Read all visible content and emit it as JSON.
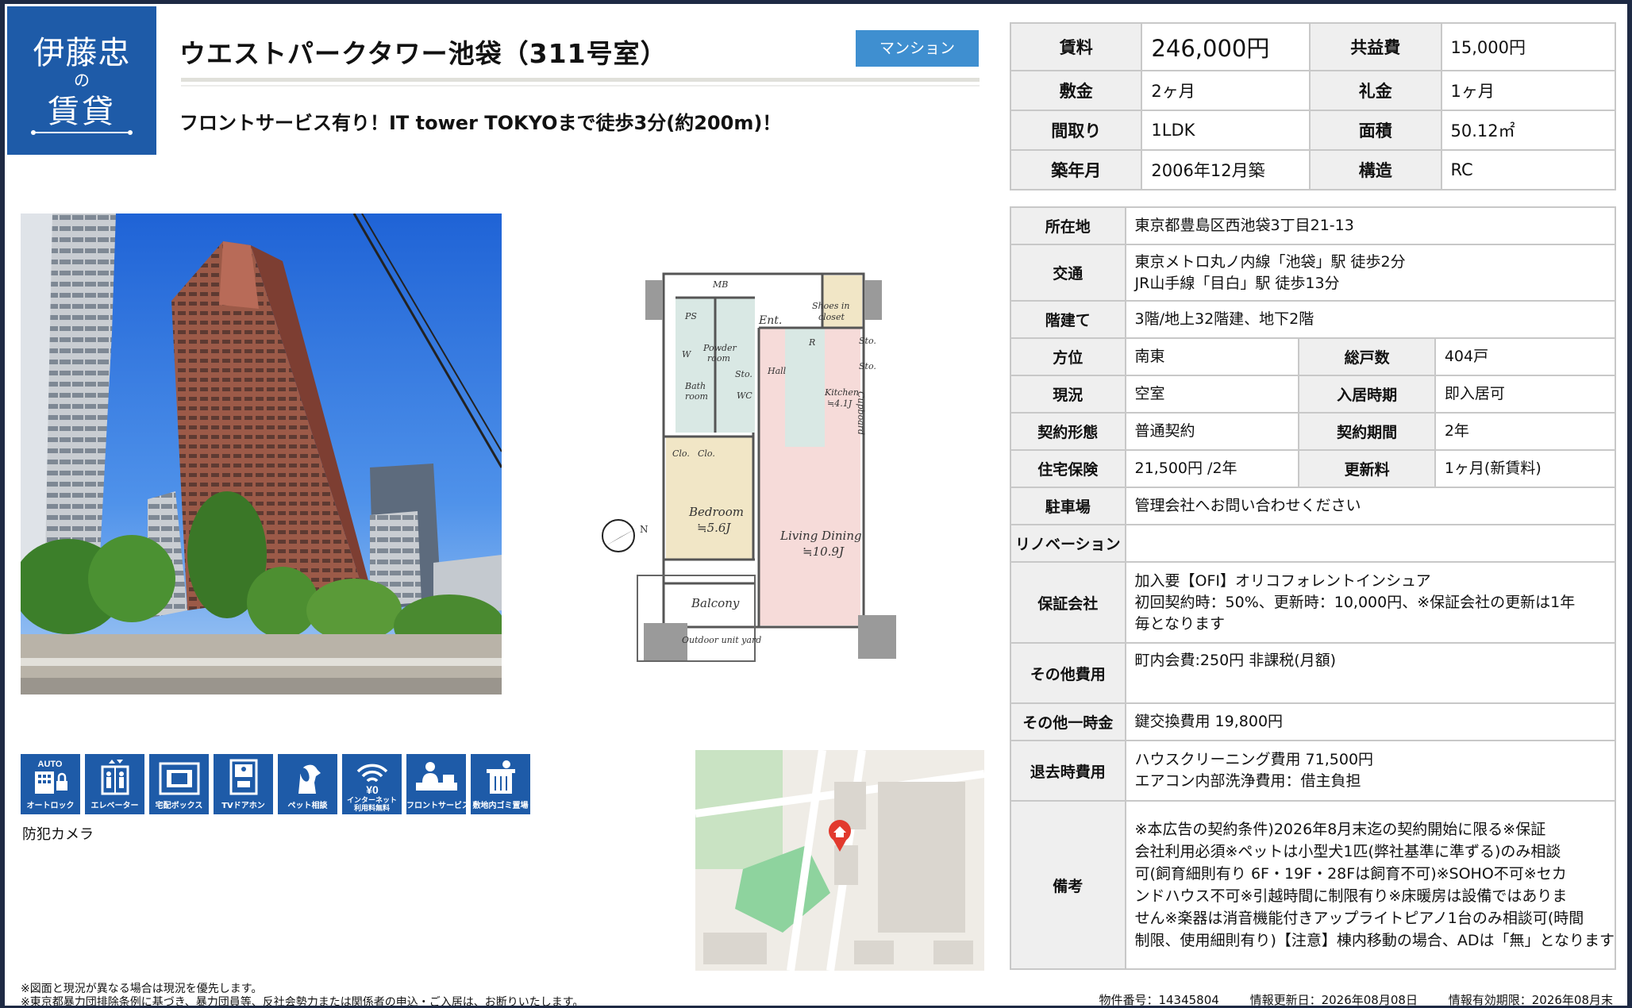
{
  "logo": {
    "line1": "伊藤忠",
    "line2": "の",
    "line3": "賃貸"
  },
  "property": {
    "title": "ウエストパークタワー池袋（311号室）",
    "type_badge": "マンション",
    "catch_copy": "フロントサービス有り！IT tower TOKYOまで徒歩3分(約200m)！"
  },
  "floorplan": {
    "labels": {
      "mb": "MB",
      "ps": "PS",
      "ent": "Ent.",
      "shoes1": "Shoes in",
      "shoes2": "closet",
      "powder1": "Powder",
      "powder2": "room",
      "w": "W",
      "sto1": "Sto.",
      "hall": "Hall",
      "r": "R",
      "sto2": "Sto.",
      "sto3": "Sto.",
      "bath1": "Bath",
      "bath2": "room",
      "wc": "WC",
      "kitchen1": "Kitchen",
      "kitchen2": "≒4.1J",
      "cupboard": "Cupboard",
      "clo1": "Clo.",
      "clo2": "Clo.",
      "bedroom1": "Bedroom",
      "bedroom2": "≒5.6J",
      "living1": "Living Dining",
      "living2": "≒10.9J",
      "balcony": "Balcony",
      "outdoor": "Outdoor unit yard",
      "north": "N"
    }
  },
  "summary": {
    "rent_label": "賃料",
    "rent": "246,000円",
    "common_fee_label": "共益費",
    "common_fee": "15,000円",
    "deposit_label": "敷金",
    "deposit": "2ヶ月",
    "key_money_label": "礼金",
    "key_money": "1ヶ月",
    "layout_label": "間取り",
    "layout": "1LDK",
    "area_label": "面積",
    "area": "50.12㎡",
    "built_label": "築年月",
    "built": "2006年12月築",
    "structure_label": "構造",
    "structure": "RC"
  },
  "details": {
    "address_label": "所在地",
    "address": "東京都豊島区西池袋3丁目21-13",
    "access_label": "交通",
    "access_1": "東京メトロ丸ノ内線「池袋」駅 徒歩2分",
    "access_2": "JR山手線「目白」駅 徒歩13分",
    "floors_label": "階建て",
    "floors": "3階/地上32階建、地下2階",
    "direction_label": "方位",
    "direction": "南東",
    "units_label": "総戸数",
    "units": "404戸",
    "status_label": "現況",
    "status": "空室",
    "move_in_label": "入居時期",
    "move_in": "即入居可",
    "contract_type_label": "契約形態",
    "contract_type": "普通契約",
    "contract_period_label": "契約期間",
    "contract_period": "2年",
    "insurance_label": "住宅保険",
    "insurance": "21,500円 /2年",
    "renewal_label": "更新料",
    "renewal": "1ヶ月(新賃料)",
    "parking_label": "駐車場",
    "parking": "管理会社へお問い合わせください",
    "renovation_label": "リノベーション",
    "renovation": "",
    "guarantor_label": "保証会社",
    "guarantor_1": "加入要【OFI】オリコフォレントインシュア",
    "guarantor_2": "初回契約時：50%、更新時：10,000円、※保証会社の更新は1年",
    "guarantor_3": "毎となります",
    "other_fees_label": "その他費用",
    "other_fees": "町内会費:250円 非課税(月額)",
    "one_time_label": "その他一時金",
    "one_time": "鍵交換費用 19,800円",
    "move_out_label": "退去時費用",
    "move_out_1": "ハウスクリーニング費用 71,500円",
    "move_out_2": "エアコン内部洗浄費用：借主負担",
    "remarks_label": "備考",
    "remarks_1": "※本広告の契約条件)2026年8月末迄の契約開始に限る※保証",
    "remarks_2": "会社利用必須※ペットは小型犬1匹(弊社基準に準ずる)のみ相談",
    "remarks_3": "可(飼育細則有り 6F・19F・28Fは飼育不可)※SOHO不可※セカ",
    "remarks_4": "ンドハウス不可※引越時間に制限有り※床暖房は設備ではありま",
    "remarks_5": "せん※楽器は消音機能付きアップライトピアノ1台のみ相談可(時間",
    "remarks_6": "制限、使用細則有り)【注意】棟内移動の場合、ADは「無」となります"
  },
  "features": [
    {
      "label": "オートロック",
      "icon": "autolock-icon",
      "badge": "AUTO"
    },
    {
      "label": "エレベーター",
      "icon": "elevator-icon"
    },
    {
      "label": "宅配ボックス",
      "icon": "delivery-box-icon"
    },
    {
      "label": "TVドアホン",
      "icon": "tv-intercom-icon",
      "badge": "TV"
    },
    {
      "label": "ペット相談",
      "icon": "pet-icon"
    },
    {
      "label_1": "インターネット",
      "label_2": "利用料無料",
      "icon": "wifi-icon",
      "badge": "¥0"
    },
    {
      "label": "フロントサービス",
      "icon": "front-service-icon"
    },
    {
      "label": "敷地内ゴミ置場",
      "icon": "garbage-icon"
    }
  ],
  "extra_feature": "防犯カメラ",
  "footer": {
    "note_1": "※図面と現況が異なる場合は現況を優先します。",
    "note_2": "※東京都暴力団排除条例に基づき、暴力団員等、反社会勢力または関係者の申込・ご入居は、お断りいたします。",
    "property_no": "物件番号：14345804",
    "updated": "情報更新日：2026年08月08日",
    "valid_until": "情報有効期限：2026年08月末"
  },
  "colors": {
    "brand_blue": "#1e5ba8",
    "badge_blue": "#3f8fd0",
    "header_gray": "#efefef",
    "bedroom": "#f1e6c6",
    "living": "#f6dbd9",
    "wet_area": "#d9e8e4"
  }
}
